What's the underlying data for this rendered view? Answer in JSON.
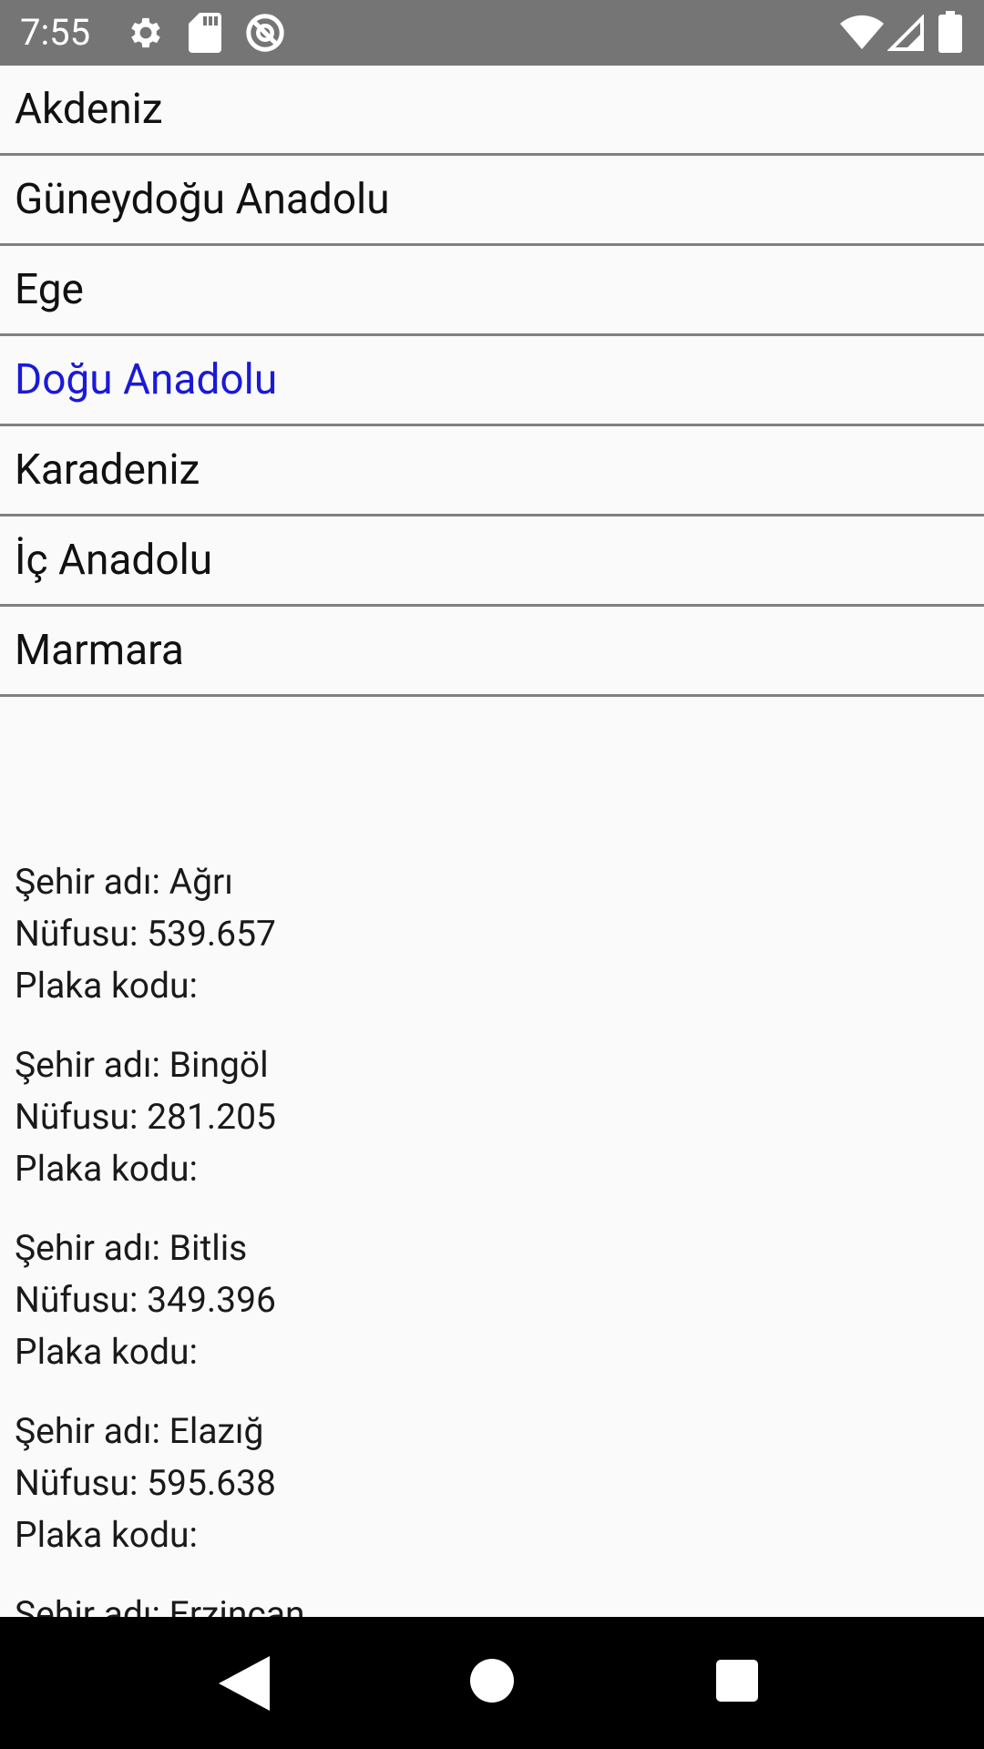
{
  "status_bar": {
    "time": "7:55",
    "icons": [
      "gear-icon",
      "sd-card-icon",
      "do-not-disturb-icon",
      "wifi-icon",
      "signal-icon",
      "battery-icon"
    ]
  },
  "regions": [
    {
      "label": "Akdeniz",
      "selected": false
    },
    {
      "label": "Güneydoğu Anadolu",
      "selected": false
    },
    {
      "label": "Ege",
      "selected": false
    },
    {
      "label": "Doğu Anadolu",
      "selected": true
    },
    {
      "label": "Karadeniz",
      "selected": false
    },
    {
      "label": "İç Anadolu",
      "selected": false
    },
    {
      "label": "Marmara",
      "selected": false
    }
  ],
  "cities": [
    {
      "name_line": "Şehir adı: Ağrı",
      "population_line": "Nüfusu: 539.657",
      "plate_line": "Plaka kodu:"
    },
    {
      "name_line": "Şehir adı: Bingöl",
      "population_line": "Nüfusu: 281.205",
      "plate_line": "Plaka kodu:"
    },
    {
      "name_line": "Şehir adı: Bitlis",
      "population_line": "Nüfusu: 349.396",
      "plate_line": "Plaka kodu:"
    },
    {
      "name_line": "Şehir adı: Elazığ",
      "population_line": "Nüfusu: 595.638",
      "plate_line": "Plaka kodu:"
    },
    {
      "name_line": "Şehir adı: Erzincan",
      "population_line": "",
      "plate_line": ""
    }
  ],
  "colors": {
    "selected_region": "#1a1ad6",
    "status_bar": "#757575",
    "nav_bar": "#000000"
  },
  "nav_bar": {
    "icons": [
      "back-icon",
      "home-icon",
      "recents-icon"
    ]
  }
}
